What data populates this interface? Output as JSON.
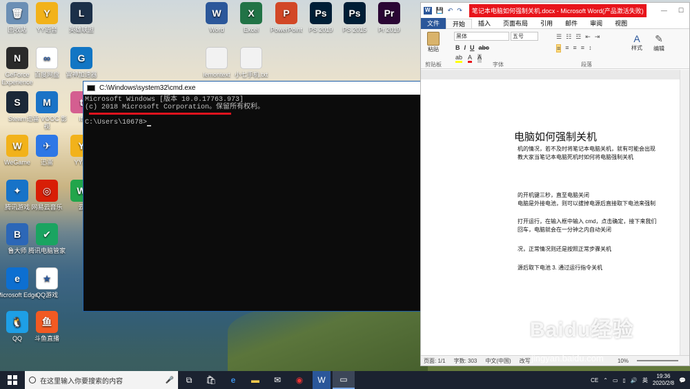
{
  "desktop": {
    "icons": [
      {
        "label": "回收站",
        "color": "#6b8fb5",
        "glyph": "🗑"
      },
      {
        "label": "YY语音",
        "color": "#f2b21a",
        "glyph": "Y"
      },
      {
        "label": "英雄联盟",
        "color": "#1c3049",
        "glyph": "L"
      },
      {
        "label": "GeForce Experience",
        "color": "#2a2a2a",
        "glyph": "N"
      },
      {
        "label": "百度网盘",
        "color": "#ffffff",
        "glyph": "∞"
      },
      {
        "label": "雷神加速器",
        "color": "#1276c4",
        "glyph": "G"
      },
      {
        "label": "Steam",
        "color": "#1b2838",
        "glyph": "S"
      },
      {
        "label": "迅雷 VOOC 影视",
        "color": "#1a73c7",
        "glyph": "M"
      },
      {
        "label": "Itt",
        "color": "#d45e90",
        "glyph": "t"
      },
      {
        "label": "WeGame",
        "color": "#f2b21a",
        "glyph": "W"
      },
      {
        "label": "迅雷",
        "color": "#2d77e6",
        "glyph": "✈"
      },
      {
        "label": "YY游",
        "color": "#f2b21a",
        "glyph": "Y"
      },
      {
        "label": "腾讯游戏",
        "color": "#1773c8",
        "glyph": "✦"
      },
      {
        "label": "网易云音乐",
        "color": "#d81e06",
        "glyph": "◎"
      },
      {
        "label": "云",
        "color": "#22a54b",
        "glyph": "W"
      },
      {
        "label": "鲁大师",
        "color": "#2c67b7",
        "glyph": "B"
      },
      {
        "label": "腾讯电脑管家",
        "color": "#1aa461",
        "glyph": "✔"
      },
      {
        "label": "Microsoft Edge",
        "color": "#0d6fd1",
        "glyph": "e"
      },
      {
        "label": "QQ游戏",
        "color": "#ffffff",
        "glyph": "★"
      },
      {
        "label": "QQ",
        "color": "#1e9fe6",
        "glyph": "🐧"
      },
      {
        "label": "斗鱼直播",
        "color": "#f25a22",
        "glyph": "鱼"
      },
      {
        "label": "Word",
        "color": "#2b579a",
        "glyph": "W"
      },
      {
        "label": "Excel",
        "color": "#217346",
        "glyph": "X"
      },
      {
        "label": "PowerPoint",
        "color": "#d24726",
        "glyph": "P"
      },
      {
        "label": "PS 2019",
        "color": "#001e36",
        "glyph": "Ps"
      },
      {
        "label": "PS 2015",
        "color": "#001e36",
        "glyph": "Ps"
      },
      {
        "label": "Pr 2019",
        "color": "#2a0634",
        "glyph": "Pr"
      },
      {
        "label": "lemontext",
        "color": "#f2f2f2",
        "glyph": ""
      },
      {
        "label": "小七手机.txt",
        "color": "#f2f2f2",
        "glyph": ""
      }
    ]
  },
  "cmd": {
    "title": "C:\\Windows\\system32\\cmd.exe",
    "line1": "Microsoft Windows [版本 10.0.17763.973]",
    "line2": "(c) 2018 Microsoft Corporation。保留所有权利。",
    "prompt": "C:\\Users\\10678>",
    "minimize": "—",
    "maximize": "☐",
    "close": "✕"
  },
  "word": {
    "title": "笔记本电脑如何强制关机.docx - Microsoft Word(产品激活失败)",
    "tabs": [
      "文件",
      "开始",
      "插入",
      "页面布局",
      "引用",
      "邮件",
      "审阅",
      "视图"
    ],
    "groups": [
      "剪贴板",
      "字体",
      "段落"
    ],
    "font_name": "黑体",
    "font_size": "五号",
    "paste": "粘贴",
    "style": "样式",
    "edit": "编辑",
    "heading": "电脑如何强制关机",
    "lines": [
      "机的情况，若不及时将笔记本电脑关机，就有可能会出现",
      "教大家当笔记本电脑死机时如何将电脑强制关机",
      "的开机键三秒，直至电脑关闭",
      "电脑是外接电池，则可以拔掉电源后直接取下电池来强制",
      "打开运行，在输入框中输入 cmd，点击确定，接下来我们",
      "回车，电脑就会在一分钟之内自动关闭",
      "况，正常情况则还是按照正常步骤关机",
      "源后取下电池 3. 通过运行指令关机"
    ],
    "status": {
      "page": "页面: 1/1",
      "words": "字数: 303",
      "lang": "中文(中国)",
      "mode": "改写",
      "zoom": "10%"
    }
  },
  "taskbar": {
    "search_placeholder": "在这里输入你要搜索的内容",
    "time": "19:36",
    "date": "2020/2/8",
    "ime": "英"
  },
  "watermark": {
    "brand": "Baidu经验",
    "url": "jingyan.baidu.com"
  }
}
